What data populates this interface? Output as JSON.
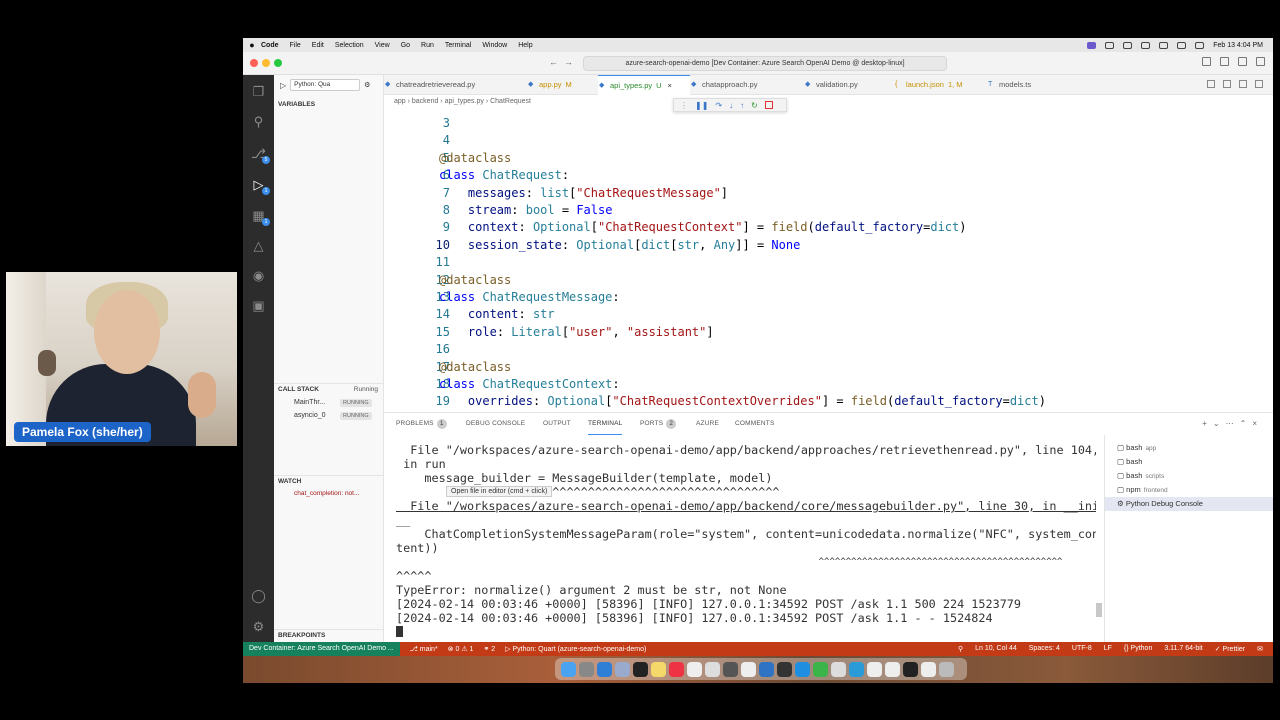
{
  "webcam": {
    "name": "Pamela Fox (she/her)"
  },
  "menubar": {
    "app": "Code",
    "items": [
      "File",
      "Edit",
      "Selection",
      "View",
      "Go",
      "Run",
      "Terminal",
      "Window",
      "Help"
    ],
    "clock": "Feb 13  4:04 PM"
  },
  "titlebar": {
    "title": "azure-search-openai-demo [Dev Container: Azure Search OpenAI Demo @ desktop-linux]"
  },
  "sidebar": {
    "run_config": "Python: Qua",
    "variables_label": "VARIABLES",
    "call_stack_label": "CALL STACK",
    "call_stack_state": "Running",
    "threads": [
      {
        "name": "MainThr...",
        "state": "RUNNING"
      },
      {
        "name": "asyncio_0",
        "state": "RUNNING"
      }
    ],
    "watch_label": "WATCH",
    "watch_expr": "chat_completion: not...",
    "breakpoints_label": "BREAKPOINTS"
  },
  "tabs": [
    {
      "label": "chatreadretrieveread.py",
      "mod": ""
    },
    {
      "label": "app.py",
      "mod": "M"
    },
    {
      "label": "api_types.py",
      "mod": "U"
    },
    {
      "label": "chatapproach.py",
      "mod": ""
    },
    {
      "label": "validation.py",
      "mod": ""
    },
    {
      "label": "launch.json",
      "mod": "1, M"
    },
    {
      "label": "models.ts",
      "mod": ""
    }
  ],
  "breadcrumb": "app  ›  backend  ›  api_types.py  ›  ChatRequest",
  "code_lines": [
    {
      "n": "3"
    },
    {
      "n": "4"
    },
    {
      "n": "5"
    },
    {
      "n": "6"
    },
    {
      "n": "7"
    },
    {
      "n": "8"
    },
    {
      "n": "9"
    },
    {
      "n": "10"
    },
    {
      "n": "11"
    },
    {
      "n": "12"
    },
    {
      "n": "13"
    },
    {
      "n": "14"
    },
    {
      "n": "15"
    },
    {
      "n": "16"
    },
    {
      "n": "17"
    },
    {
      "n": "18"
    },
    {
      "n": "19"
    }
  ],
  "code": {
    "l5": "@dataclass",
    "l6a": "class",
    "l6b": "ChatRequest",
    "l6c": ":",
    "l7a": "messages",
    "l7b": ": ",
    "l7c": "list",
    "l7d": "[",
    "l7e": "\"ChatRequestMessage\"",
    "l7f": "]",
    "l8a": "stream",
    "l8b": ": ",
    "l8c": "bool",
    "l8d": " = ",
    "l8e": "False",
    "l9a": "context",
    "l9b": ": ",
    "l9c": "Optional",
    "l9d": "[",
    "l9e": "\"ChatRequestContext\"",
    "l9f": "] = ",
    "l9g": "field",
    "l9h": "(",
    "l9i": "default_factory",
    "l9j": "=",
    "l9k": "dict",
    "l9l": ")",
    "l10a": "session_state",
    "l10b": ": ",
    "l10c": "Optional",
    "l10d": "[",
    "l10e": "dict",
    "l10f": "[",
    "l10g": "str",
    "l10h": ", ",
    "l10i": "Any",
    "l10j": "]] = ",
    "l10k": "None",
    "l12": "@dataclass",
    "l13a": "class",
    "l13b": "ChatRequestMessage",
    "l13c": ":",
    "l14a": "content",
    "l14b": ": ",
    "l14c": "str",
    "l15a": "role",
    "l15b": ": ",
    "l15c": "Literal",
    "l15d": "[",
    "l15e": "\"user\"",
    "l15f": ", ",
    "l15g": "\"assistant\"",
    "l15h": "]",
    "l17": "@dataclass",
    "l18a": "class",
    "l18b": "ChatRequestContext",
    "l18c": ":",
    "l19a": "overrides",
    "l19b": ": ",
    "l19c": "Optional",
    "l19d": "[",
    "l19e": "\"ChatRequestContextOverrides\"",
    "l19f": "] = ",
    "l19g": "field",
    "l19h": "(",
    "l19i": "default_factory",
    "l19j": "=",
    "l19k": "dict",
    "l19l": ")"
  },
  "panel": {
    "tabs": [
      {
        "label": "PROBLEMS",
        "badge": "1"
      },
      {
        "label": "DEBUG CONSOLE",
        "badge": ""
      },
      {
        "label": "OUTPUT",
        "badge": ""
      },
      {
        "label": "TERMINAL",
        "badge": ""
      },
      {
        "label": "PORTS",
        "badge": "2"
      },
      {
        "label": "AZURE",
        "badge": ""
      },
      {
        "label": "COMMENTS",
        "badge": ""
      }
    ],
    "terminal_lines": [
      "  File \"/workspaces/azure-search-openai-demo/app/backend/approaches/retrievethenread.py\", line 104,",
      " in run",
      "    message_builder = MessageBuilder(template, model)",
      "                      ^^^^^^^^^^^^^^^^^^^^^^^^^^^^^^^^",
      "  File \"/workspaces/azure-search-openai-demo/app/backend/core/messagebuilder.py\", line 30, in __init",
      "__",
      "    ChatCompletionSystemMessageParam(role=\"system\", content=unicodedata.normalize(\"NFC\", system_con",
      "tent))",
      "                                                                              ^^^^^^^^^^^^^^^^^^^^^^^^^^^^^^^^^^^^^^^^^^^^^",
      "^^^^^",
      "TypeError: normalize() argument 2 must be str, not None",
      "[2024-02-14 00:03:46 +0000] [58396] [INFO] 127.0.0.1:34592 POST /ask 1.1 500 224 1523779",
      "[2024-02-14 00:03:46 +0000] [58396] [INFO] 127.0.0.1:34592 POST /ask 1.1 - - 1524824"
    ],
    "tooltip": "Open file in editor (cmd + click)",
    "terminals": [
      {
        "name": "bash",
        "sub": "app"
      },
      {
        "name": "bash",
        "sub": ""
      },
      {
        "name": "bash",
        "sub": "scripts"
      },
      {
        "name": "npm",
        "sub": "frontend"
      },
      {
        "name": "Python Debug Console",
        "sub": ""
      }
    ]
  },
  "status": {
    "remote": "Dev Container: Azure Search OpenAI Demo ...",
    "branch": "main*",
    "problems": "⊗ 0 ⚠ 1",
    "ports": "⚭ 2",
    "debug": "Python: Quart (azure-search-openai-demo)",
    "position": "Ln 10, Col 44",
    "spaces": "Spaces: 4",
    "encoding": "UTF-8",
    "eol": "LF",
    "language": "Python",
    "interpreter": "3.11.7 64-bit",
    "prettier": "✓ Prettier"
  },
  "colors": {
    "accent": "#3b8eea",
    "statusbar": "#c23b16",
    "remote": "#16825d"
  }
}
